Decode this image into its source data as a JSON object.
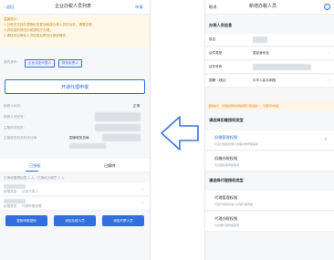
{
  "left": {
    "nav": {
      "back": "返回",
      "title": "企业办税人员列表",
      "apply": "申请"
    },
    "notice": {
      "head": "温馨提示：",
      "line1": "1.目前仅支持办理授权变更及新增办税人员的业务，需要变更",
      "line2": "人员信息的请去办税服务厅办理。",
      "line3": "2.请核实后授权人员信息后再进行授权操作。"
    },
    "role": {
      "label": "我的身份：",
      "tag1": "企业法定代表人",
      "tag2": "财务负责人"
    },
    "open_button": "开通代理申报",
    "fields": {
      "status_label": "纳税人状态：",
      "status_value": "正常",
      "id_label": "纳税人识别号：",
      "authority_label": "主管税务机关：",
      "authority_extra": "主管税务机关科所分局：",
      "authority_value": "国家税务总局"
    },
    "tabs": {
      "t1": "已授权",
      "t2": "已解除"
    },
    "summary": "已授权管理权限 1 人，已授权办税员 1 人",
    "records": {
      "r1_label": "权限类型：",
      "r1_value": "法定代表人",
      "r2_label": "权限类型：",
      "r2_value": "代理申报权限"
    },
    "buttons": {
      "b1": "更换申报密码",
      "b2": "添加办税人员",
      "b3": "添加开票人员"
    }
  },
  "right": {
    "nav": {
      "cancel": "取消",
      "title": "新增办税人员",
      "help_icon": "?"
    },
    "section1": "办税人员信息",
    "form": {
      "name": "姓名",
      "doc_type": "证件类型",
      "doc_type_value": "居民身份证",
      "doc_no": "证件号码",
      "nation": "国籍（地区）",
      "nation_value": "中华人民共和国"
    },
    "tip": "温馨提示：管理权限和办税权限只能选其一，无需同时授权",
    "section2": "请选择扣缴授权类型",
    "opt1": {
      "title": "扣缴管理权限",
      "desc": "可自行或授权他人办理扣缴申报事项"
    },
    "opt2": {
      "title": "扣缴办税权限",
      "desc": "可办理扣缴申报事项"
    },
    "section3": "请选择代理授权类型",
    "opt3": {
      "title": "代理管理权限",
      "desc": "可自行或授权他人办理代理申报"
    },
    "opt4": {
      "title": "代理办税权限",
      "desc": "可办理代理申报事项"
    }
  },
  "arrow": {
    "icon": "left-arrow-icon",
    "color": "#3b78d8"
  },
  "colors": {
    "accent": "#2f6fe0",
    "check": "#2f6fe0"
  }
}
